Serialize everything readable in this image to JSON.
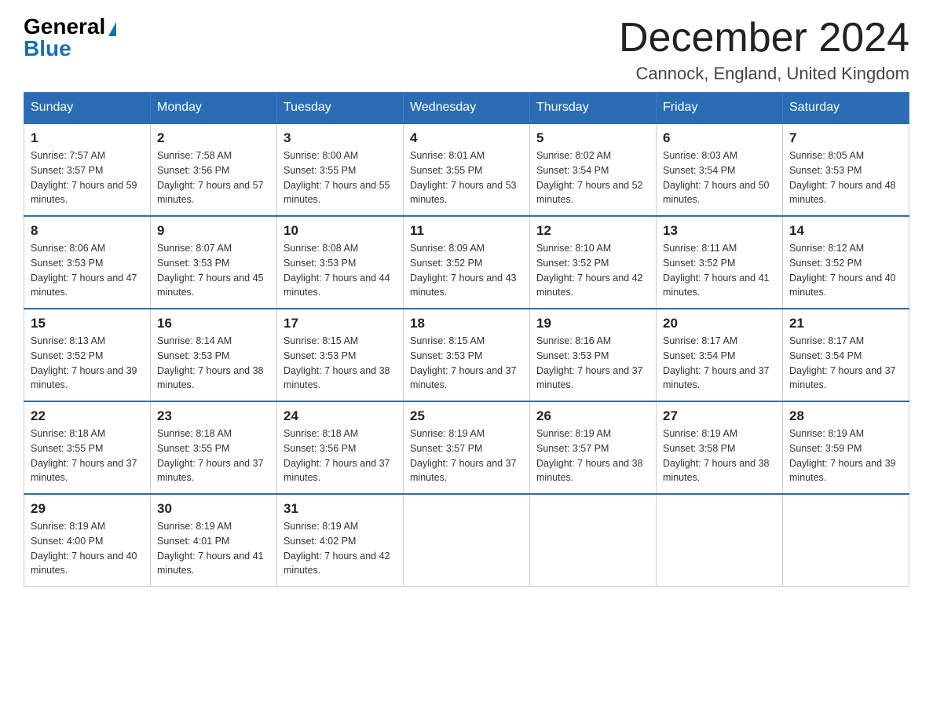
{
  "logo": {
    "general_text": "General",
    "blue_text": "Blue"
  },
  "title": {
    "month_year": "December 2024",
    "location": "Cannock, England, United Kingdom"
  },
  "days_of_week": [
    "Sunday",
    "Monday",
    "Tuesday",
    "Wednesday",
    "Thursday",
    "Friday",
    "Saturday"
  ],
  "weeks": [
    [
      {
        "day": "1",
        "sunrise": "7:57 AM",
        "sunset": "3:57 PM",
        "daylight": "7 hours and 59 minutes."
      },
      {
        "day": "2",
        "sunrise": "7:58 AM",
        "sunset": "3:56 PM",
        "daylight": "7 hours and 57 minutes."
      },
      {
        "day": "3",
        "sunrise": "8:00 AM",
        "sunset": "3:55 PM",
        "daylight": "7 hours and 55 minutes."
      },
      {
        "day": "4",
        "sunrise": "8:01 AM",
        "sunset": "3:55 PM",
        "daylight": "7 hours and 53 minutes."
      },
      {
        "day": "5",
        "sunrise": "8:02 AM",
        "sunset": "3:54 PM",
        "daylight": "7 hours and 52 minutes."
      },
      {
        "day": "6",
        "sunrise": "8:03 AM",
        "sunset": "3:54 PM",
        "daylight": "7 hours and 50 minutes."
      },
      {
        "day": "7",
        "sunrise": "8:05 AM",
        "sunset": "3:53 PM",
        "daylight": "7 hours and 48 minutes."
      }
    ],
    [
      {
        "day": "8",
        "sunrise": "8:06 AM",
        "sunset": "3:53 PM",
        "daylight": "7 hours and 47 minutes."
      },
      {
        "day": "9",
        "sunrise": "8:07 AM",
        "sunset": "3:53 PM",
        "daylight": "7 hours and 45 minutes."
      },
      {
        "day": "10",
        "sunrise": "8:08 AM",
        "sunset": "3:53 PM",
        "daylight": "7 hours and 44 minutes."
      },
      {
        "day": "11",
        "sunrise": "8:09 AM",
        "sunset": "3:52 PM",
        "daylight": "7 hours and 43 minutes."
      },
      {
        "day": "12",
        "sunrise": "8:10 AM",
        "sunset": "3:52 PM",
        "daylight": "7 hours and 42 minutes."
      },
      {
        "day": "13",
        "sunrise": "8:11 AM",
        "sunset": "3:52 PM",
        "daylight": "7 hours and 41 minutes."
      },
      {
        "day": "14",
        "sunrise": "8:12 AM",
        "sunset": "3:52 PM",
        "daylight": "7 hours and 40 minutes."
      }
    ],
    [
      {
        "day": "15",
        "sunrise": "8:13 AM",
        "sunset": "3:52 PM",
        "daylight": "7 hours and 39 minutes."
      },
      {
        "day": "16",
        "sunrise": "8:14 AM",
        "sunset": "3:53 PM",
        "daylight": "7 hours and 38 minutes."
      },
      {
        "day": "17",
        "sunrise": "8:15 AM",
        "sunset": "3:53 PM",
        "daylight": "7 hours and 38 minutes."
      },
      {
        "day": "18",
        "sunrise": "8:15 AM",
        "sunset": "3:53 PM",
        "daylight": "7 hours and 37 minutes."
      },
      {
        "day": "19",
        "sunrise": "8:16 AM",
        "sunset": "3:53 PM",
        "daylight": "7 hours and 37 minutes."
      },
      {
        "day": "20",
        "sunrise": "8:17 AM",
        "sunset": "3:54 PM",
        "daylight": "7 hours and 37 minutes."
      },
      {
        "day": "21",
        "sunrise": "8:17 AM",
        "sunset": "3:54 PM",
        "daylight": "7 hours and 37 minutes."
      }
    ],
    [
      {
        "day": "22",
        "sunrise": "8:18 AM",
        "sunset": "3:55 PM",
        "daylight": "7 hours and 37 minutes."
      },
      {
        "day": "23",
        "sunrise": "8:18 AM",
        "sunset": "3:55 PM",
        "daylight": "7 hours and 37 minutes."
      },
      {
        "day": "24",
        "sunrise": "8:18 AM",
        "sunset": "3:56 PM",
        "daylight": "7 hours and 37 minutes."
      },
      {
        "day": "25",
        "sunrise": "8:19 AM",
        "sunset": "3:57 PM",
        "daylight": "7 hours and 37 minutes."
      },
      {
        "day": "26",
        "sunrise": "8:19 AM",
        "sunset": "3:57 PM",
        "daylight": "7 hours and 38 minutes."
      },
      {
        "day": "27",
        "sunrise": "8:19 AM",
        "sunset": "3:58 PM",
        "daylight": "7 hours and 38 minutes."
      },
      {
        "day": "28",
        "sunrise": "8:19 AM",
        "sunset": "3:59 PM",
        "daylight": "7 hours and 39 minutes."
      }
    ],
    [
      {
        "day": "29",
        "sunrise": "8:19 AM",
        "sunset": "4:00 PM",
        "daylight": "7 hours and 40 minutes."
      },
      {
        "day": "30",
        "sunrise": "8:19 AM",
        "sunset": "4:01 PM",
        "daylight": "7 hours and 41 minutes."
      },
      {
        "day": "31",
        "sunrise": "8:19 AM",
        "sunset": "4:02 PM",
        "daylight": "7 hours and 42 minutes."
      },
      null,
      null,
      null,
      null
    ]
  ]
}
